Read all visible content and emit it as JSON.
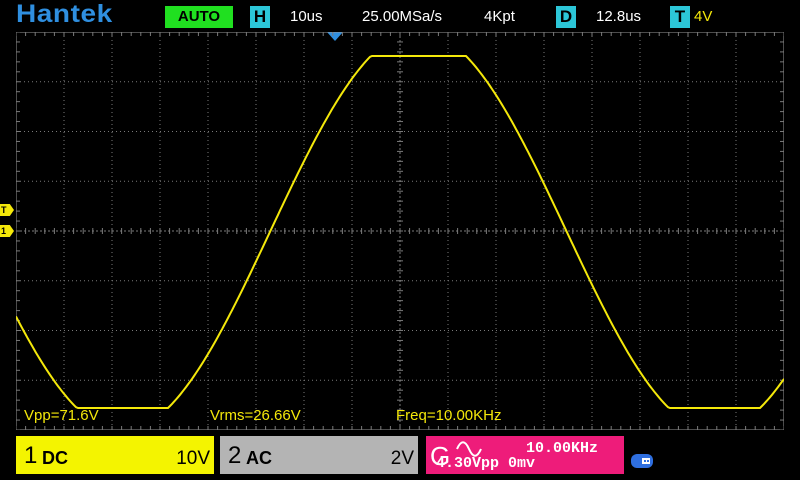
{
  "header": {
    "brand": "Hantek",
    "run_mode": "AUTO",
    "horizontal_tag": "H",
    "timebase": "10us",
    "sample_rate": "25.00MSa/s",
    "memory_depth": "4Kpt",
    "delay_tag": "D",
    "delay": "12.8us",
    "trigger_tag": "T",
    "trigger_level": "4V"
  },
  "plot": {
    "trigger_marker": "T",
    "channel1_marker": "1",
    "trace_color": "#f4e80a",
    "grid_color": "#7a7a7a"
  },
  "measurements": {
    "vpp": "Vpp=71.6V",
    "vrms": "Vrms=26.66V",
    "freq": "Freq=10.00KHz"
  },
  "channels": {
    "ch1": {
      "number": "1",
      "coupling": "DC",
      "scale": "10V",
      "color": "#f4f400"
    },
    "ch2": {
      "number": "2",
      "coupling": "AC",
      "scale": "2V",
      "color": "#b4b4b4"
    }
  },
  "generator": {
    "letter": "G",
    "frequency": "10.00KHz",
    "amplitude": "4.30Vpp",
    "offset": "0mv",
    "waveform": "sine-icon",
    "color": "#ee1c7a"
  },
  "status_icons": {
    "usb": "usb-icon"
  }
}
